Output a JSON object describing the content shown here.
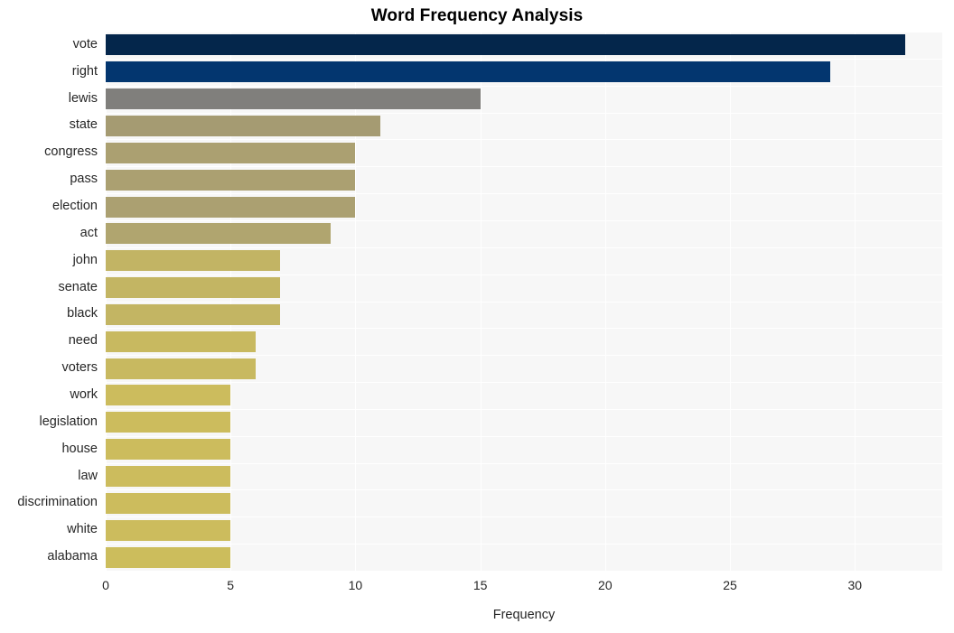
{
  "chart_data": {
    "type": "bar",
    "orientation": "horizontal",
    "title": "Word Frequency Analysis",
    "xlabel": "Frequency",
    "ylabel": "",
    "categories": [
      "vote",
      "right",
      "lewis",
      "state",
      "congress",
      "pass",
      "election",
      "act",
      "john",
      "senate",
      "black",
      "need",
      "voters",
      "work",
      "legislation",
      "house",
      "law",
      "discrimination",
      "white",
      "alabama"
    ],
    "values": [
      32,
      29,
      15,
      11,
      10,
      10,
      10,
      9,
      7,
      7,
      7,
      6,
      6,
      5,
      5,
      5,
      5,
      5,
      5,
      5
    ],
    "bar_colors": [
      "#04264b",
      "#03366f",
      "#807f7c",
      "#a59b72",
      "#aba071",
      "#aba071",
      "#aba071",
      "#b0a56f",
      "#c2b464",
      "#c3b563",
      "#c3b563",
      "#c8b960",
      "#c8b960",
      "#ccbc5d",
      "#ccbc5d",
      "#ccbc5d",
      "#ccbc5d",
      "#ccbc5d",
      "#ccbc5d",
      "#ccbd5c"
    ],
    "xticks": [
      0,
      5,
      10,
      15,
      20,
      25,
      30
    ],
    "xlim": [
      0,
      33.5
    ],
    "grid": true,
    "legend": "none",
    "plot_background": "#f7f7f7",
    "gridline_color": "#ffffff",
    "text_color": "#262626"
  }
}
